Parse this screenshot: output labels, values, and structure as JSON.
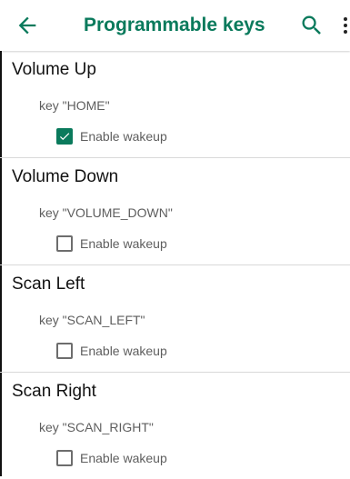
{
  "colors": {
    "accent": "#0a7a5c",
    "text_primary": "#121212",
    "text_secondary": "#5e5e5e"
  },
  "appbar": {
    "title": "Programmable keys",
    "back_icon": "arrow-left-icon",
    "search_icon": "search-icon",
    "overflow_icon": "more-vert-icon"
  },
  "keys": [
    {
      "title": "Volume Up",
      "key": "key \"HOME\"",
      "wakeup_label": "Enable wakeup",
      "wakeup_checked": true
    },
    {
      "title": "Volume Down",
      "key": "key \"VOLUME_DOWN\"",
      "wakeup_label": "Enable wakeup",
      "wakeup_checked": false
    },
    {
      "title": "Scan Left",
      "key": "key \"SCAN_LEFT\"",
      "wakeup_label": "Enable wakeup",
      "wakeup_checked": false
    },
    {
      "title": "Scan Right",
      "key": "key \"SCAN_RIGHT\"",
      "wakeup_label": "Enable wakeup",
      "wakeup_checked": false
    }
  ]
}
